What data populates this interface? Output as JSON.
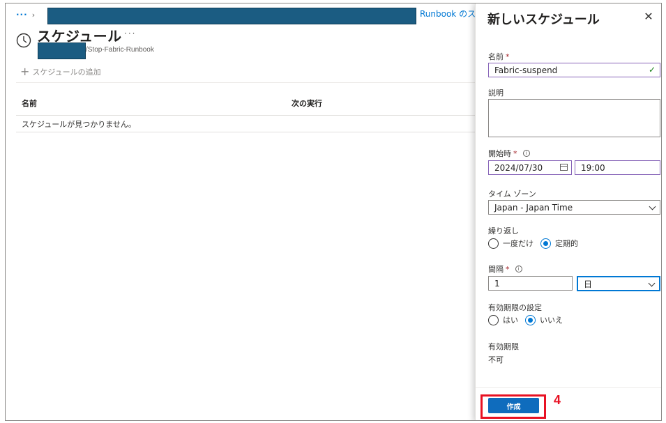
{
  "breadcrumb": {
    "dots": "···",
    "chevron": "›",
    "link": "Runbook のスケ"
  },
  "page": {
    "title": "スケジュール",
    "more": "···",
    "subtitle": "/Stop-Fabric-Runbook"
  },
  "toolbar": {
    "add_label": "スケジュールの追加"
  },
  "table": {
    "columns": [
      "名前",
      "次の実行"
    ],
    "empty_message": "スケジュールが見つかりません。"
  },
  "panel": {
    "title": "新しいスケジュール",
    "close": "✕",
    "name": {
      "label": "名前",
      "required": "*",
      "value": "Fabric-suspend"
    },
    "description": {
      "label": "説明",
      "value": ""
    },
    "start": {
      "label": "開始時",
      "required": "*",
      "date": "2024/07/30",
      "time": "19:00"
    },
    "timezone": {
      "label": "タイム ゾーン",
      "selected": "Japan - Japan Time"
    },
    "recurrence": {
      "label": "繰り返し",
      "options": [
        "一度だけ",
        "定期的"
      ],
      "selected": "定期的"
    },
    "interval": {
      "label": "間隔",
      "required": "*",
      "value": "1",
      "unit": "日"
    },
    "expiry_setting": {
      "label": "有効期限の設定",
      "options": [
        "はい",
        "いいえ"
      ],
      "selected": "いいえ"
    },
    "expiry": {
      "label": "有効期限",
      "value": "不可"
    },
    "create_label": "作成"
  },
  "annotation": {
    "step": "4"
  },
  "colors": {
    "accent": "#0078d4",
    "redaction": "#1b5c82",
    "highlight": "#e81123",
    "valid_border": "#8764b8"
  }
}
